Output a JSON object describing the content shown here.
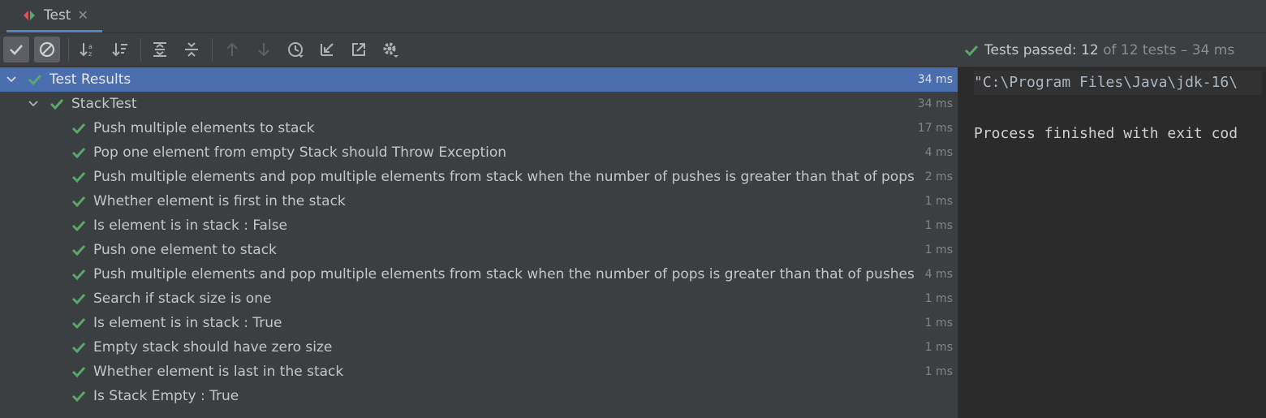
{
  "tab": {
    "label": "Test",
    "close": "✕"
  },
  "colors": {
    "accent": "#4a88c7",
    "selection": "#4b6eaf",
    "pass": "#59a869"
  },
  "toolbar": {
    "buttons": [
      "show-passed-icon",
      "show-ignored-icon",
      "sort-alpha-icon",
      "sort-duration-icon",
      "expand-all-icon",
      "collapse-all-icon",
      "prev-failed-icon",
      "next-failed-icon",
      "test-history-icon",
      "import-tests-icon",
      "export-tests-icon",
      "settings-gear-icon"
    ]
  },
  "status": {
    "label": "Tests passed:",
    "count": "12",
    "rest": "of 12 tests – 34 ms"
  },
  "tree": {
    "root": {
      "label": "Test Results",
      "time": "34 ms"
    },
    "suite": {
      "label": "StackTest",
      "time": "34 ms"
    },
    "tests": [
      {
        "label": "Push multiple elements to stack",
        "time": "17 ms"
      },
      {
        "label": "Pop one element from empty Stack should Throw Exception",
        "time": "4 ms"
      },
      {
        "label": "Push multiple elements and pop multiple elements from stack when the number of pushes is greater than that of pops",
        "time": "2 ms"
      },
      {
        "label": "Whether element is first in the stack",
        "time": "1 ms"
      },
      {
        "label": "Is element is in stack : False",
        "time": "1 ms"
      },
      {
        "label": "Push one element to stack",
        "time": "1 ms"
      },
      {
        "label": "Push multiple elements and pop multiple elements from stack when the number of pops is greater than that of pushes",
        "time": "4 ms"
      },
      {
        "label": "Search if stack size is one",
        "time": "1 ms"
      },
      {
        "label": "Is element is in stack : True",
        "time": "1 ms"
      },
      {
        "label": "Empty stack should have zero size",
        "time": "1 ms"
      },
      {
        "label": "Whether element is last in the stack",
        "time": "1 ms"
      },
      {
        "label": "Is Stack Empty : True",
        "time": ""
      }
    ]
  },
  "console": {
    "command": "\"C:\\Program Files\\Java\\jdk-16\\",
    "finished": "Process finished with exit cod"
  }
}
